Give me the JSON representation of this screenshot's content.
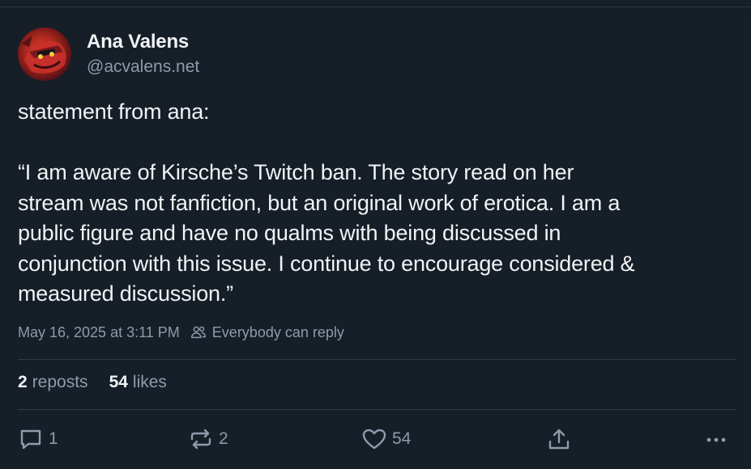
{
  "author": {
    "name": "Ana Valens",
    "handle": "@acvalens.net"
  },
  "post": {
    "lines": [
      "statement from ana:",
      "",
      "“I am aware of Kirsche’s Twitch ban. The story read on her",
      "stream was not fanfiction, but an original work of erotica. I am a",
      "public figure and have no qualms with being discussed in",
      "conjunction with this issue. I continue to encourage considered &",
      "measured discussion.”"
    ],
    "timestamp": "May 16, 2025 at 3:11 PM",
    "reply_setting": "Everybody can reply"
  },
  "stats": {
    "reposts_count": "2",
    "reposts_label": "reposts",
    "likes_count": "54",
    "likes_label": "likes"
  },
  "actions": {
    "reply_count": "1",
    "repost_count": "2",
    "like_count": "54"
  },
  "icons": {
    "reply": "speech-bubble-icon",
    "repost": "repost-arrows-icon",
    "like": "heart-icon",
    "share": "share-upload-icon",
    "more": "ellipsis-icon",
    "audience": "people-icon"
  },
  "colors": {
    "background": "#161e27",
    "text": "#f1f3f5",
    "muted": "#8d9bab",
    "divider": "#2e3a48"
  }
}
